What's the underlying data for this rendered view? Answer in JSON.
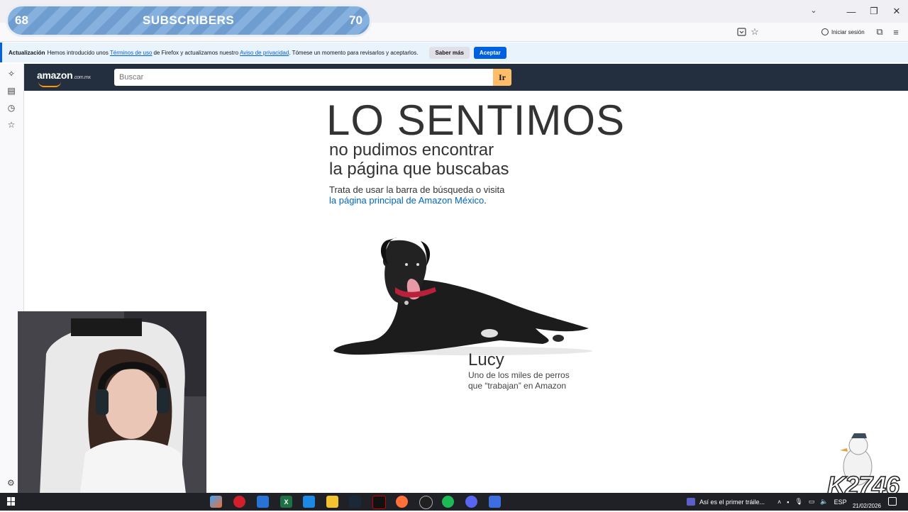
{
  "browser": {
    "signin_label": "Iniciar sesión"
  },
  "notification": {
    "prefix": "Actualización",
    "text1": "Hemos introducido unos",
    "terms_link": "Términos de uso",
    "text2": "de Firefox y actualizamos nuestro",
    "privacy_link": "Aviso de privacidad",
    "text3": ". Tómese un momento para revisarlos y aceptarlos.",
    "learn_more_button": "Saber más",
    "accept_button": "Aceptar"
  },
  "amazon": {
    "logo_text": "amazon",
    "logo_suffix": ".com.mx",
    "search_placeholder": "Buscar",
    "search_button": "Ir"
  },
  "page": {
    "title": "LO SENTIMOS",
    "subtitle_line1": "no pudimos encontrar",
    "subtitle_line2": "la página que buscabas",
    "hint": "Trata de usar la barra de búsqueda o visita",
    "home_link": "la página principal de Amazon México",
    "home_link_period": ".",
    "dog_name": "Lucy",
    "dog_caption_line1": "Uno de los miles de perros",
    "dog_caption_line2": "que “trabajan” en Amazon"
  },
  "overlay": {
    "subs_left": "68",
    "subs_label": "SUBSCRIBERS",
    "subs_right": "70",
    "watermark": "K2746"
  },
  "taskbar": {
    "media_title": "Así es el primer tráile...",
    "language": "ESP",
    "date": "21/02/2026"
  },
  "colors": {
    "amazon_header": "#232f3e",
    "amazon_orange": "#febd69",
    "firefox_blue": "#0061e0",
    "link_blue": "#0066c0"
  }
}
